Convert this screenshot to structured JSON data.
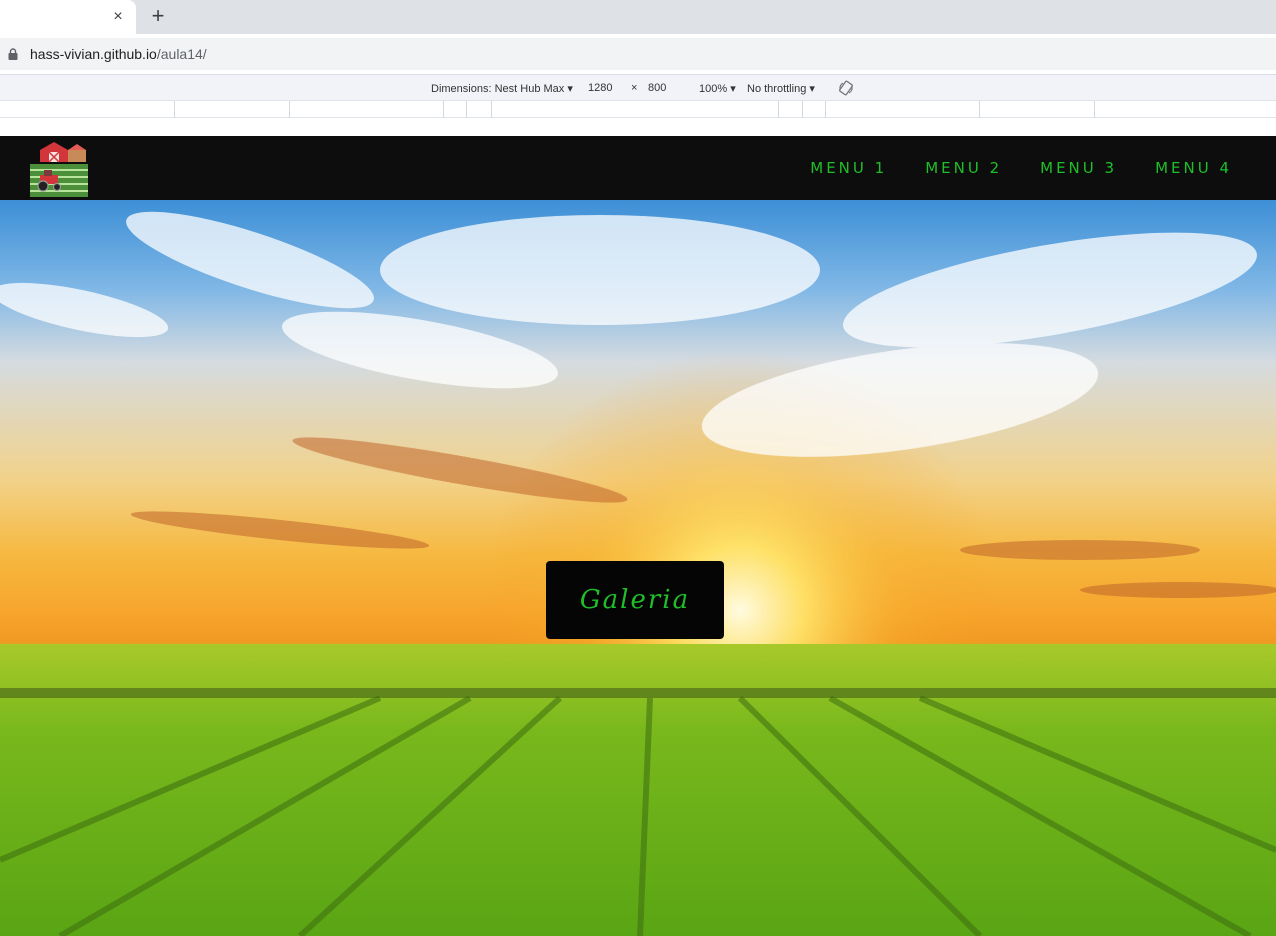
{
  "browser": {
    "tab_close": "×",
    "new_tab": "+",
    "url_host": "hass-vivian.github.io",
    "url_path": "/aula14/"
  },
  "devtools": {
    "dimensions_label": "Dimensions: Nest Hub Max ▾",
    "width": "1280",
    "times": "×",
    "height": "800",
    "zoom": "100% ▾",
    "throttling": "No throttling ▾"
  },
  "site": {
    "logo_icon": "farm-barn-tractor-icon",
    "menu": [
      "MENU 1",
      "MENU 2",
      "MENU 3",
      "MENU 4"
    ],
    "accent_color": "#1fbf2a",
    "gallery_button": "Galeria"
  }
}
